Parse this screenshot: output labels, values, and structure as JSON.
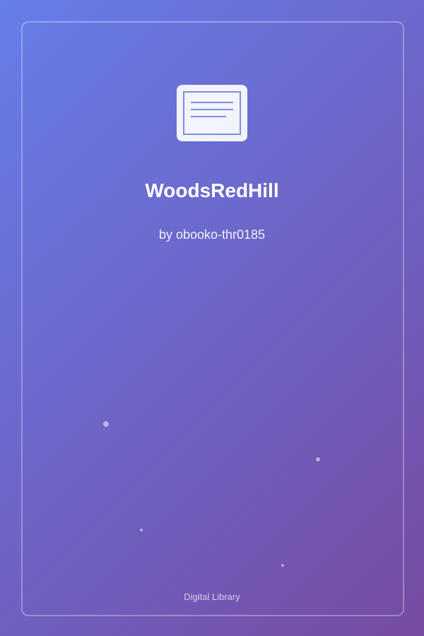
{
  "cover": {
    "title": "WoodsRedHill",
    "author": "by obooko-thr0185",
    "footer": "Digital Library",
    "icon": "book-page-icon",
    "colors": {
      "gradient_start": "#667eea",
      "gradient_end": "#764ba2",
      "icon_stroke": "#7b8ee0"
    }
  }
}
